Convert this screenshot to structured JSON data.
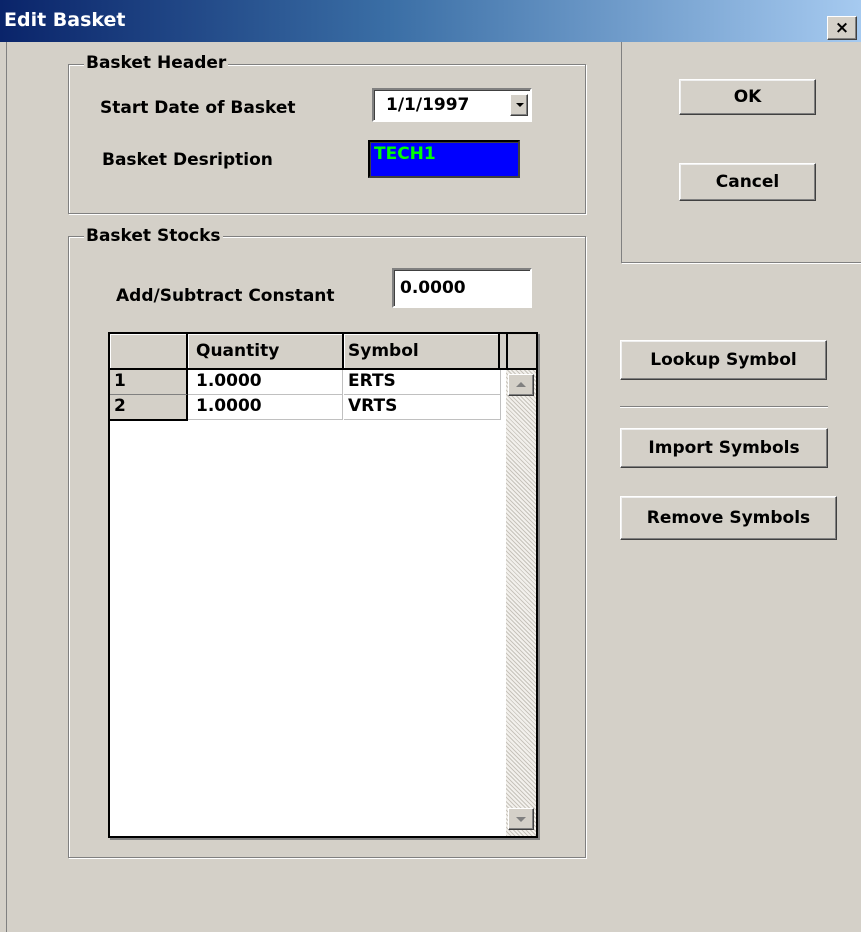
{
  "window": {
    "title": "Edit Basket",
    "close_glyph": "×"
  },
  "header_group": {
    "legend": "Basket Header",
    "start_date_label": "Start Date of Basket",
    "start_date_value": "1/1/1997",
    "description_label": "Basket Desription",
    "description_value": "TECH1"
  },
  "stocks_group": {
    "legend": "Basket Stocks",
    "constant_label": "Add/Subtract Constant",
    "constant_value": "0.0000"
  },
  "grid": {
    "columns": [
      "Quantity",
      "Symbol"
    ],
    "rows": [
      {
        "index": "1",
        "quantity": "1.0000",
        "symbol": "ERTS"
      },
      {
        "index": "2",
        "quantity": "1.0000",
        "symbol": "VRTS"
      }
    ]
  },
  "buttons": {
    "ok": "OK",
    "cancel": "Cancel",
    "lookup": "Lookup Symbol",
    "import": "Import Symbols",
    "remove": "Remove Symbols"
  },
  "colors": {
    "description_bg": "#0000ff",
    "description_text": "#00ff00",
    "title_gradient_start": "#0a246a"
  }
}
